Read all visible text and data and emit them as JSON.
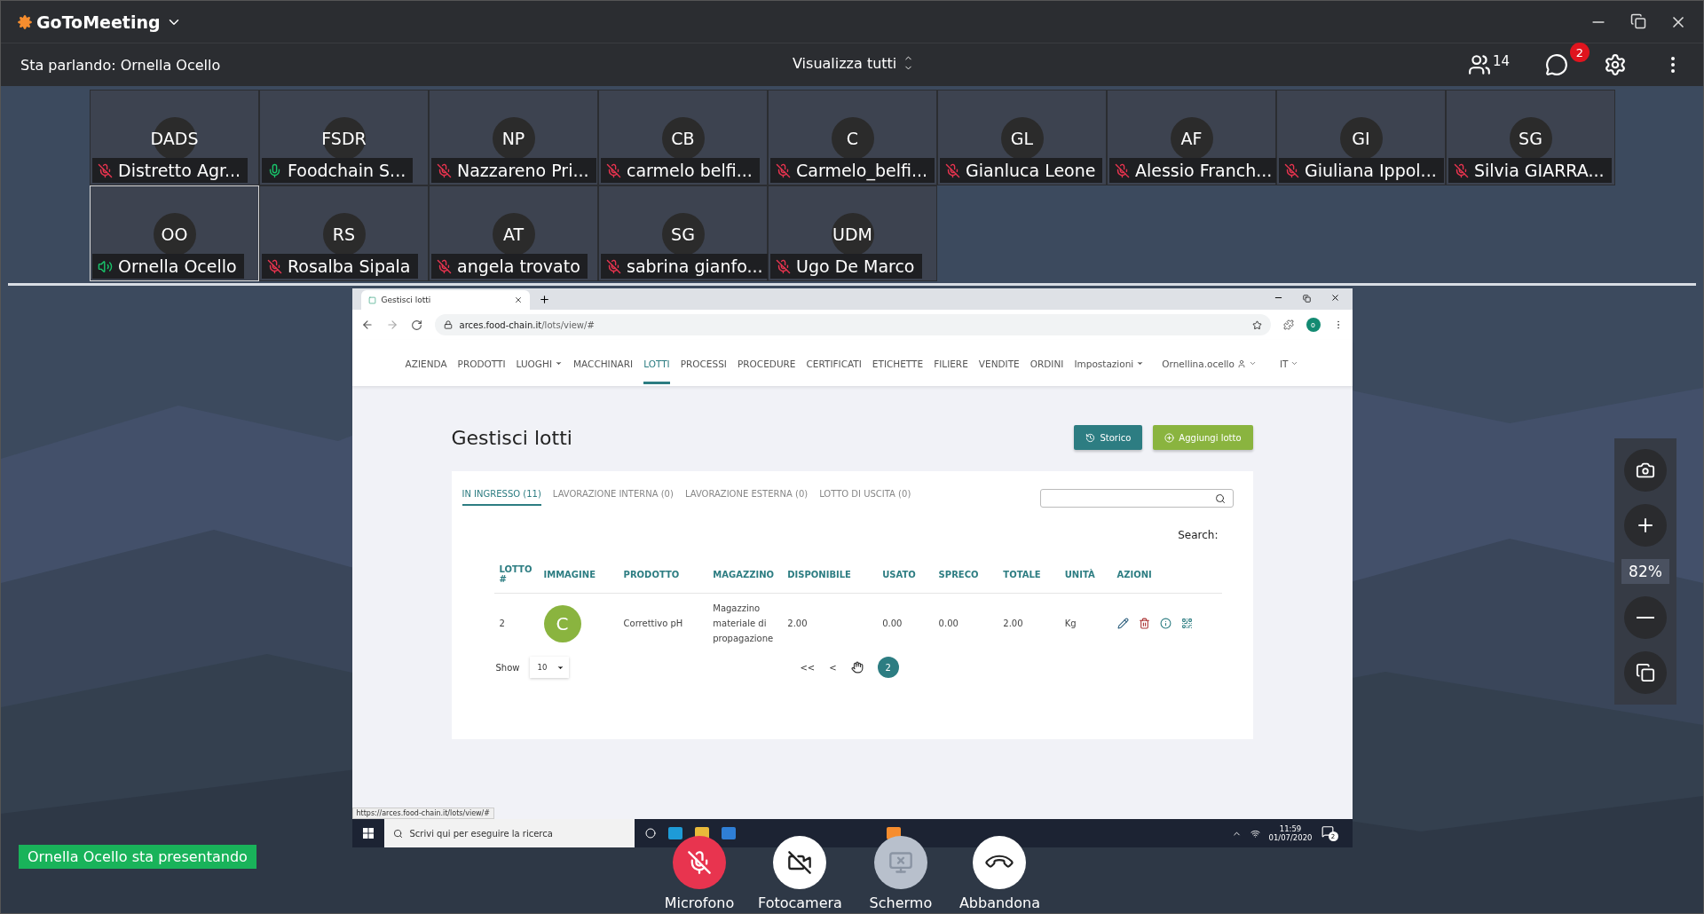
{
  "app": {
    "logo": "GoToMeeting",
    "speaking": "Sta parlando: Ornella Ocello",
    "view_mode": "Visualizza tutti",
    "participants_count": "14",
    "chat_badge": "2"
  },
  "participants": [
    {
      "initials": "DADS",
      "name": "Distretto Agr...",
      "muted": true,
      "selected": false
    },
    {
      "initials": "FSDR",
      "name": "Foodchain  S...",
      "muted": false,
      "speaking": false,
      "selected": false
    },
    {
      "initials": "NP",
      "name": "Nazzareno Pri...",
      "muted": true,
      "selected": false
    },
    {
      "initials": "CB",
      "name": "carmelo belfi...",
      "muted": true,
      "selected": false
    },
    {
      "initials": "C",
      "name": "Carmelo_belfi...",
      "muted": true,
      "selected": false
    },
    {
      "initials": "GL",
      "name": "Gianluca Leone",
      "muted": true,
      "selected": false
    },
    {
      "initials": "AF",
      "name": "Alessio Franch...",
      "muted": true,
      "selected": false
    },
    {
      "initials": "GI",
      "name": "Giuliana Ippol...",
      "muted": true,
      "selected": false
    },
    {
      "initials": "SG",
      "name": "Silvia GIARRA...",
      "muted": true,
      "selected": false
    },
    {
      "initials": "OO",
      "name": "Ornella Ocello",
      "muted": false,
      "speaking": true,
      "selected": true
    },
    {
      "initials": "RS",
      "name": "Rosalba Sipala",
      "muted": true,
      "selected": false
    },
    {
      "initials": "AT",
      "name": "angela trovato",
      "muted": true,
      "selected": false
    },
    {
      "initials": "SG",
      "name": "sabrina gianfo...",
      "muted": true,
      "selected": false
    },
    {
      "initials": "UDM",
      "name": "Ugo De Marco",
      "muted": true,
      "selected": false
    }
  ],
  "browser": {
    "tab_title": "Gestisci lotti",
    "url_host": "arces.food-chain.it",
    "url_path": "/lots/view/#",
    "profile": "o",
    "nav": [
      {
        "label": "AZIENDA",
        "dropdown": false,
        "selected": false
      },
      {
        "label": "PRODOTTI",
        "dropdown": false,
        "selected": false
      },
      {
        "label": "LUOGHI",
        "dropdown": true,
        "selected": false
      },
      {
        "label": "MACCHINARI",
        "dropdown": false,
        "selected": false
      },
      {
        "label": "LOTTI",
        "dropdown": false,
        "selected": true
      },
      {
        "label": "PROCESSI",
        "dropdown": false,
        "selected": false
      },
      {
        "label": "PROCEDURE",
        "dropdown": false,
        "selected": false
      },
      {
        "label": "CERTIFICATI",
        "dropdown": false,
        "selected": false
      },
      {
        "label": "ETICHETTE",
        "dropdown": false,
        "selected": false
      },
      {
        "label": "FILIERE",
        "dropdown": false,
        "selected": false
      },
      {
        "label": "VENDITE",
        "dropdown": false,
        "selected": false
      },
      {
        "label": "ORDINI",
        "dropdown": false,
        "selected": false
      },
      {
        "label": "Impostazioni",
        "dropdown": true,
        "selected": false
      }
    ],
    "user": "Ornellina.ocello",
    "language": "IT",
    "status_url": "https://arces.food-chain.it/lots/view/#"
  },
  "page": {
    "title": "Gestisci lotti",
    "buttons": [
      {
        "label": "Storico",
        "kind": "history"
      },
      {
        "label": "Aggiungi lotto",
        "kind": "add"
      }
    ],
    "tabs": [
      {
        "label": "IN INGRESSO (11)",
        "selected": true
      },
      {
        "label": "LAVORAZIONE INTERNA (0)",
        "selected": false
      },
      {
        "label": "LAVORAZIONE ESTERNA (0)",
        "selected": false
      },
      {
        "label": "LOTTO DI USCITA (0)",
        "selected": false
      }
    ],
    "search_label": "Search:",
    "columns": [
      "LOTTO #",
      "IMMAGINE",
      "PRODOTTO",
      "MAGAZZINO",
      "DISPONIBILE",
      "USATO",
      "SPRECO",
      "TOTALE",
      "UNITÀ",
      "AZIONI"
    ],
    "rows": [
      {
        "lotto": "2",
        "image_letter": "C",
        "prodotto": "Correttivo pH",
        "magazzino": "Magazzino materiale di propagazione",
        "disponibile": "2.00",
        "usato": "0.00",
        "spreco": "0.00",
        "totale": "2.00",
        "unita": "Kg"
      }
    ],
    "show_label": "Show",
    "page_size": "10",
    "pager": [
      "<<",
      "<"
    ],
    "current_page": "2"
  },
  "taskbar": {
    "search_placeholder": "Scrivi qui per eseguire la ricerca",
    "time": "11:59",
    "date": "01/07/2020",
    "notifications": "2"
  },
  "zoom_level": "82%",
  "presenter_banner": "Ornella Ocello sta presentando",
  "controls": [
    {
      "label": "Microfono",
      "kind": "mic",
      "highlighted": true,
      "disabled": false
    },
    {
      "label": "Fotocamera",
      "kind": "camera",
      "highlighted": false,
      "disabled": false
    },
    {
      "label": "Schermo",
      "kind": "screen",
      "highlighted": false,
      "disabled": true
    },
    {
      "label": "Abbandona",
      "kind": "leave",
      "highlighted": false,
      "disabled": false
    }
  ]
}
